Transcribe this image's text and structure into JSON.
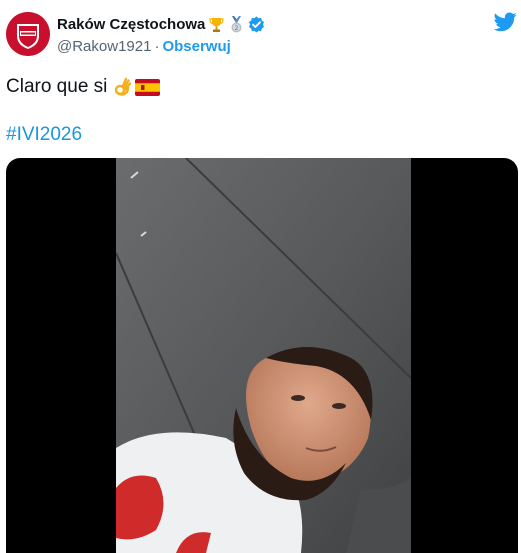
{
  "tweet": {
    "author": {
      "display_name": "Raków Częstochowa",
      "handle": "@Rakow1921",
      "separator": "·",
      "follow_label": "Obserwuj",
      "avatar_icon": "club-crest-icon",
      "badges": [
        "trophy-icon",
        "silver-medal-icon",
        "verified-badge-icon"
      ]
    },
    "brand_icon": "twitter-bird-icon",
    "text": "Claro que si",
    "emojis": [
      "ok-hand-emoji",
      "spain-flag-emoji"
    ],
    "hashtag": "#IVI2026",
    "media": {
      "type": "video"
    }
  },
  "colors": {
    "link_blue": "#1d9bf0",
    "hashtag_blue": "#1b95e0",
    "crest_red": "#c8102e",
    "media_bg": "#000000"
  }
}
